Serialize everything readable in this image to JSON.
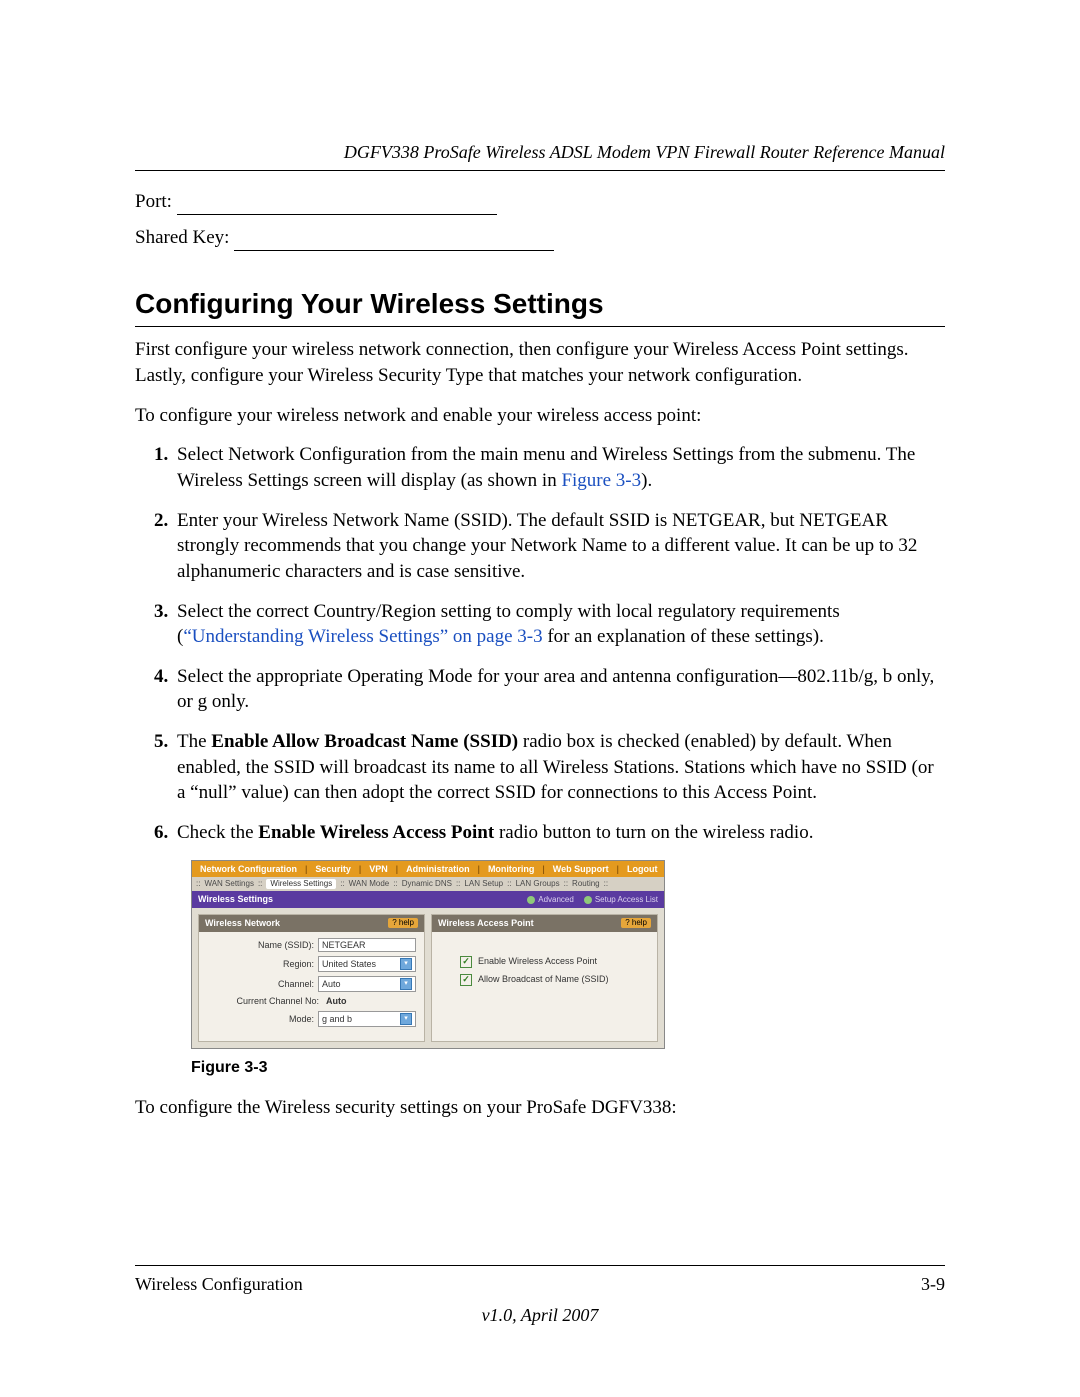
{
  "header": {
    "title": "DGFV338 ProSafe Wireless ADSL Modem VPN Firewall Router Reference Manual"
  },
  "form": {
    "port_label": "Port: ",
    "sharedkey_label": "Shared Key: "
  },
  "section_title": "Configuring Your Wireless Settings",
  "intro_p1": "First configure your wireless network connection, then configure your Wireless Access Point settings. Lastly, configure your Wireless Security Type that matches your network configuration.",
  "intro_p2": "To configure your wireless network and enable your wireless access point:",
  "steps": {
    "s1a": "Select Network Configuration from the main menu and Wireless Settings from the submenu. The Wireless Settings screen will display (as shown in ",
    "s1_link": "Figure 3-3",
    "s1b": ").",
    "s2": "Enter your Wireless Network Name (SSID). The default SSID is NETGEAR, but NETGEAR strongly recommends that you change your Network Name to a different value. It can be up to 32 alphanumeric characters and is case sensitive.",
    "s3a": "Select the correct Country/Region setting to comply with local regulatory requirements (",
    "s3_link": "“Understanding Wireless Settings” on page 3-3",
    "s3b": " for an explanation of these settings).",
    "s4": "Select the appropriate Operating Mode for your area and antenna configuration—802.11b/g, b only, or g only.",
    "s5a": "The ",
    "s5_bold": "Enable Allow Broadcast Name (SSID)",
    "s5b": " radio box is checked (enabled) by default. When enabled, the SSID will broadcast its name to all Wireless Stations. Stations which have no SSID (or a “null” value) can then adopt the correct SSID for connections to this Access Point.",
    "s6a": "Check the ",
    "s6_bold": "Enable Wireless Access Point",
    "s6b": " radio button to turn on the wireless radio."
  },
  "screenshot": {
    "topmenu": [
      "Network Configuration",
      "Security",
      "VPN",
      "Administration",
      "Monitoring",
      "Web Support",
      "Logout"
    ],
    "submenu": [
      "WAN Settings",
      "Wireless Settings",
      "WAN Mode",
      "Dynamic DNS",
      "LAN Setup",
      "LAN Groups",
      "Routing"
    ],
    "bar_title": "Wireless Settings",
    "bar_links": [
      "Advanced",
      "Setup Access List"
    ],
    "panel_left": {
      "title": "Wireless Network",
      "help": "help",
      "rows": {
        "name_label": "Name (SSID):",
        "name_value": "NETGEAR",
        "region_label": "Region:",
        "region_value": "United States",
        "channel_label": "Channel:",
        "channel_value": "Auto",
        "curchan_label": "Current Channel No:",
        "curchan_value": "Auto",
        "mode_label": "Mode:",
        "mode_value": "g and b"
      }
    },
    "panel_right": {
      "title": "Wireless Access Point",
      "help": "help",
      "chk1": "Enable Wireless Access Point",
      "chk2": "Allow Broadcast of Name (SSID)"
    }
  },
  "figure_caption": "Figure 3-3",
  "outro": "To configure the Wireless security settings on your ProSafe DGFV338:",
  "footer": {
    "left": "Wireless Configuration",
    "right": "3-9",
    "version": "v1.0, April 2007"
  }
}
